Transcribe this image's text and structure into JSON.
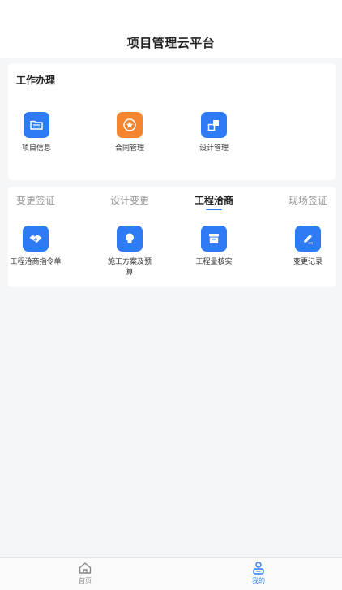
{
  "header": {
    "title": "项目管理云平台"
  },
  "work_section": {
    "title": "工作办理",
    "items": [
      {
        "label": "项目信息",
        "icon": "folder-icon",
        "color": "#2f7bf5"
      },
      {
        "label": "合同管理",
        "icon": "seal-star-icon",
        "color": "#f5862f"
      },
      {
        "label": "设计管理",
        "icon": "design-squares-icon",
        "color": "#2f7bf5"
      }
    ]
  },
  "tabs_section": {
    "tabs": [
      {
        "label": "变更签证"
      },
      {
        "label": "设计变更"
      },
      {
        "label": "工程洽商",
        "active": true
      },
      {
        "label": "现场签证"
      }
    ],
    "items": [
      {
        "label": "工程洽商指令单",
        "icon": "handshake-icon",
        "color": "#2f7bf5"
      },
      {
        "label": "施工方案及预算",
        "icon": "lightbulb-icon",
        "color": "#2f7bf5"
      },
      {
        "label": "工程量核实",
        "icon": "archive-box-icon",
        "color": "#2f7bf5"
      },
      {
        "label": "变更记录",
        "icon": "edit-pen-icon",
        "color": "#2f7bf5"
      }
    ]
  },
  "bottom_nav": {
    "items": [
      {
        "label": "首页",
        "icon": "home-icon",
        "color": "#888888"
      },
      {
        "label": "我的",
        "icon": "user-icon",
        "color": "#2f7bf5",
        "active": true
      }
    ]
  }
}
